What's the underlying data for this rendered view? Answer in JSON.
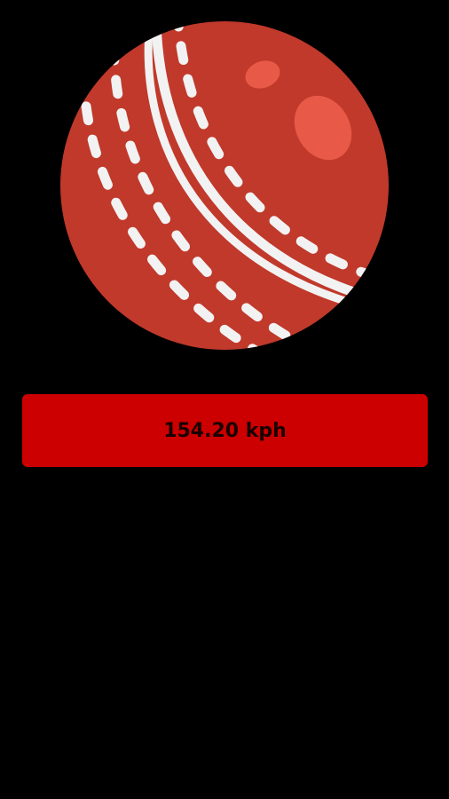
{
  "speed": {
    "value_text": "154.20 kph"
  },
  "ball": {
    "icon": "cricket-ball-icon"
  },
  "colors": {
    "background": "#000000",
    "ball": "#c0392b",
    "seam": "#f2f2f2",
    "highlight": "#e85a47",
    "bar": "#cc0000"
  }
}
